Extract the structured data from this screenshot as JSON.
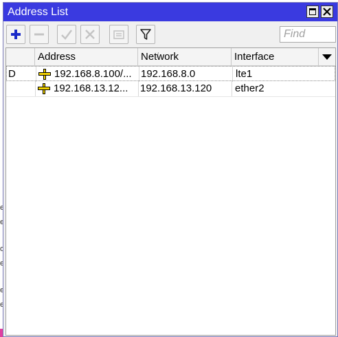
{
  "window": {
    "title": "Address List"
  },
  "toolbar": {
    "add_icon": "plus-icon",
    "remove_icon": "minus-icon",
    "enable_icon": "check-icon",
    "disable_icon": "x-icon",
    "comment_icon": "note-icon",
    "filter_icon": "filter-icon",
    "find_placeholder": "Find"
  },
  "table": {
    "columns": [
      "",
      "Address",
      "Network",
      "Interface"
    ],
    "sort_indicator": "/",
    "rows": [
      {
        "flag": "D",
        "address": "192.168.8.100/...",
        "network": "192.168.8.0",
        "interface": "lte1"
      },
      {
        "flag": "",
        "address": "192.168.13.12...",
        "network": "192.168.13.120",
        "interface": "ether2"
      }
    ]
  },
  "background": {
    "fragments": [
      "e",
      "e",
      "o",
      "e",
      "e",
      "e"
    ]
  },
  "colors": {
    "titlebar": "#3a3ae0",
    "add_icon": "#1a2ac8",
    "ip_icon_yellow": "#f2d200"
  }
}
